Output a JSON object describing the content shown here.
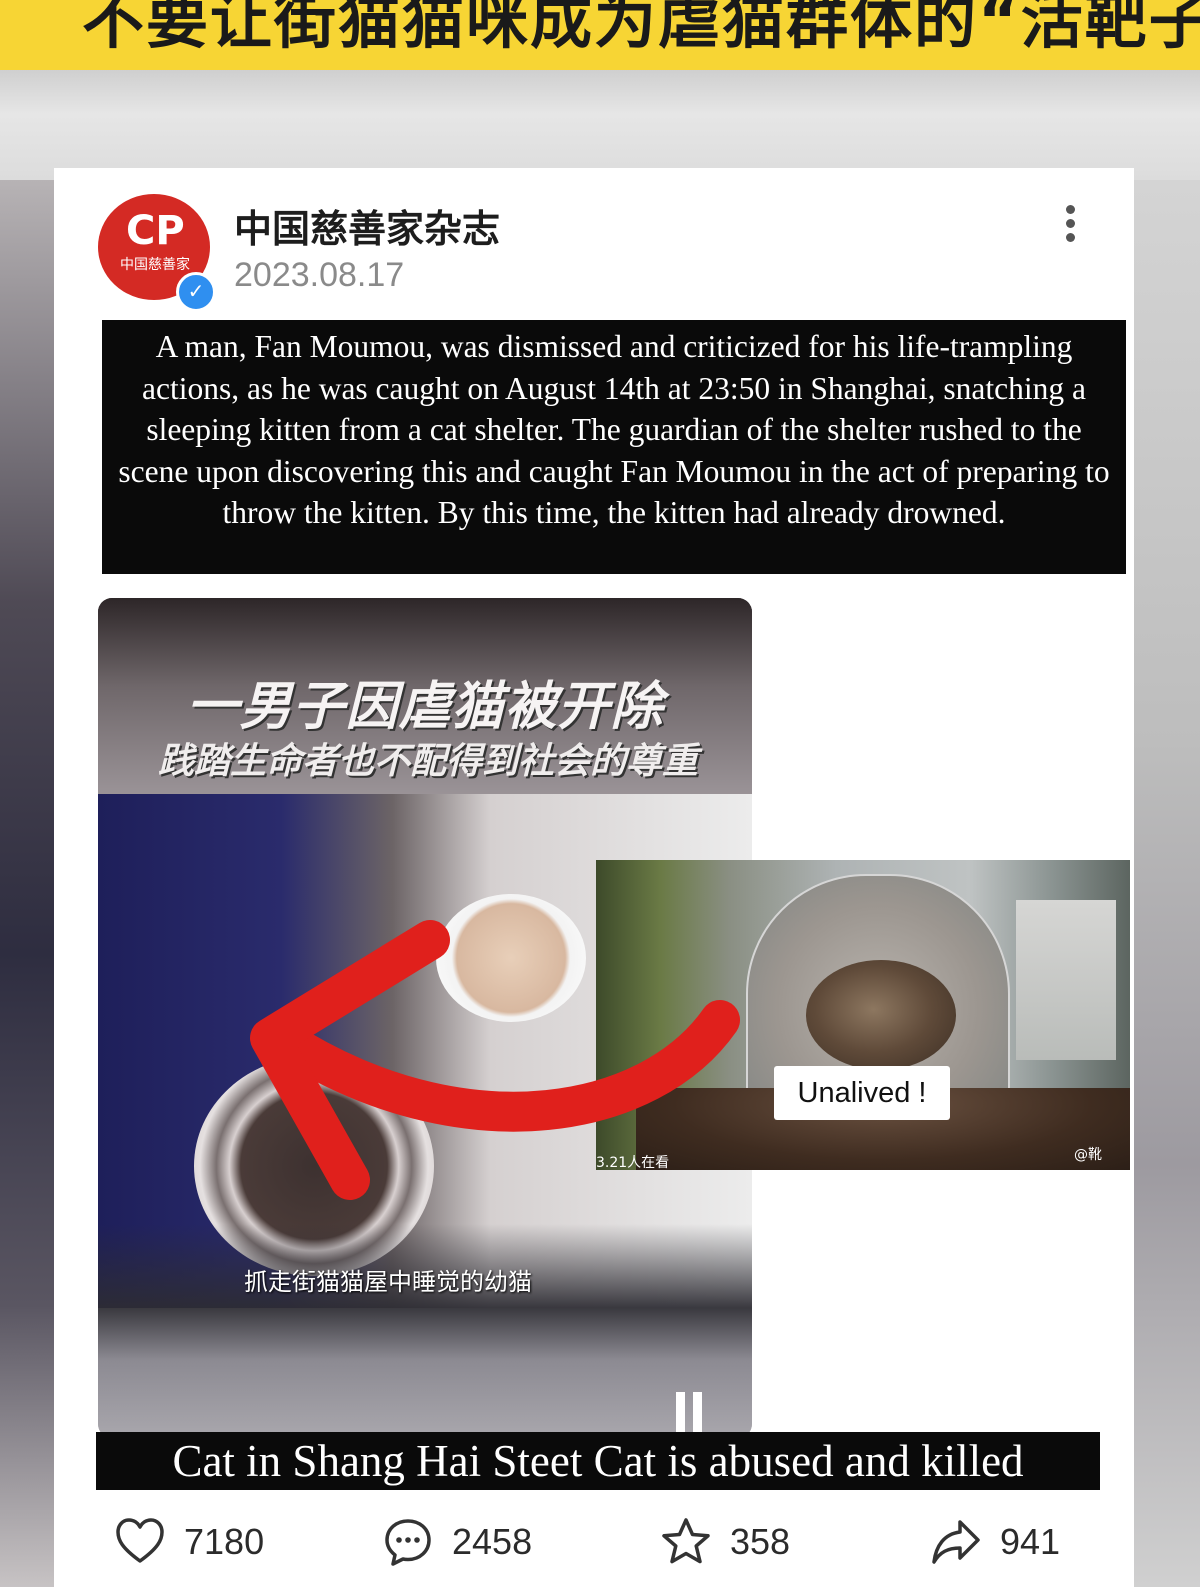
{
  "banner": {
    "text": "不要让街猫猫咪成为虐猫群体的“活靶子”"
  },
  "post": {
    "account_name": "中国慈善家杂志",
    "date": "2023.08.17",
    "avatar_logo": "CP",
    "avatar_org": "中国慈善家",
    "caption": "A man, Fan Moumou, was dismissed and criticized for his life-trampling actions, as he was caught on August 14th at 23:50 in Shanghai, snatching a sleeping kitten from a cat shelter. The guardian of the shelter rushed to the scene upon discovering this and caught Fan Moumou in the act of preparing to throw the kitten. By this time, the kitten had already drowned."
  },
  "video": {
    "title": "一男子因虐猫被开除",
    "subtitle": "践踏生命者也不配得到社会的尊重",
    "scene_text": "抓走街猫猫屋中睡觉的幼猫"
  },
  "inset": {
    "label": "Unalived !",
    "viewers": "3.21人在看",
    "watermark": "@靴"
  },
  "bottom_caption": "Cat in Shang Hai Steet Cat is abused and killed",
  "actions": {
    "likes": "7180",
    "comments": "2458",
    "favorites": "358",
    "shares": "941"
  },
  "colors": {
    "banner": "#f7d534",
    "avatar": "#d42a24",
    "verified": "#2f8ff0",
    "arrow": "#e0201c"
  }
}
